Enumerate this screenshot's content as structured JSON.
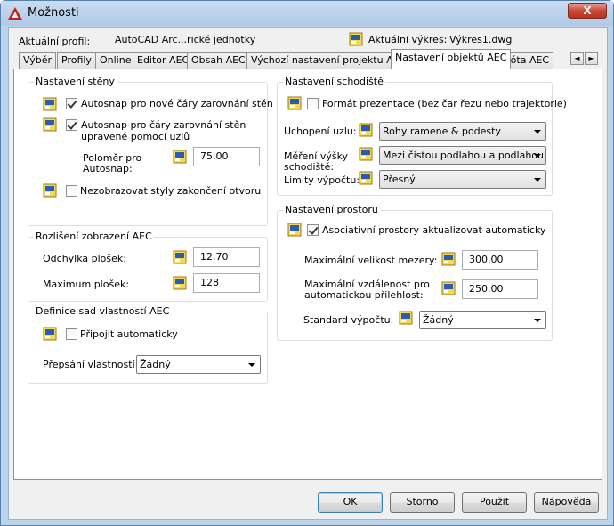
{
  "window": {
    "title": "Možnosti",
    "close_label": "X"
  },
  "profile": {
    "label": "Aktuální profil:",
    "value": "AutoCAD Arc...rické jednotky"
  },
  "drawing": {
    "label": "Aktuální výkres:",
    "value": "Výkres1.dwg"
  },
  "tabs": [
    "Výběr",
    "Profily",
    "Online",
    "Editor AEC",
    "Obsah AEC",
    "Výchozí nastavení projektu AEC",
    "Nastavení objektů AEC",
    "Kóta AEC"
  ],
  "active_tab": "Nastavení objektů AEC",
  "tab_scroll": {
    "left": "◄",
    "right": "►"
  },
  "wall": {
    "title": "Nastavení stěny",
    "autosnap_new": {
      "label": "Autosnap pro nové čáry zarovnání stěn",
      "checked": true
    },
    "autosnap_grip": {
      "label1": "Autosnap pro čáry zarovnání stěn",
      "label2": "upravené pomocí uzlů",
      "checked": true
    },
    "radius": {
      "label1": "Poloměr pro",
      "label2": "Autosnap:",
      "value": "75.00"
    },
    "no_opening_styles": {
      "label": "Nezobrazovat styly zakončení otvoru",
      "checked": false
    }
  },
  "resolution": {
    "title": "Rozlišení zobrazení AEC",
    "deviation": {
      "label": "Odchylka plošek:",
      "value": "12.70"
    },
    "max": {
      "label": "Maximum plošek:",
      "value": "128"
    }
  },
  "propsets": {
    "title": "Definice sad vlastností AEC",
    "attach": {
      "label": "Připojit automaticky",
      "checked": false
    },
    "override": {
      "label": "Přepsání vlastností",
      "value": "Žádný"
    }
  },
  "stairs": {
    "title": "Nastavení schodiště",
    "presentation": {
      "label": "Formát prezentace (bez čar řezu nebo trajektorie)",
      "checked": false
    },
    "node_grip": {
      "label": "Uchopení uzlu:",
      "value": "Rohy ramene & podesty"
    },
    "measure": {
      "label1": "Měření výšky",
      "label2": "schodiště:",
      "value": "Mezi čistou podlahou a podlahou"
    },
    "calc_limits": {
      "label": "Limity výpočtu:",
      "value": "Přesný"
    }
  },
  "space": {
    "title": "Nastavení prostoru",
    "assoc": {
      "label": "Asociativní prostory aktualizovat automaticky",
      "checked": true
    },
    "max_gap": {
      "label": "Maximální velikost mezery:",
      "value": "300.00"
    },
    "max_dist": {
      "label1": "Maximální vzdálenost pro",
      "label2": "automatickou přilehlost:",
      "value": "250.00"
    },
    "standard": {
      "label": "Standard výpočtu:",
      "value": "Žádný"
    }
  },
  "buttons": {
    "ok": "OK",
    "cancel": "Storno",
    "apply": "Použít",
    "help": "Nápověda"
  }
}
